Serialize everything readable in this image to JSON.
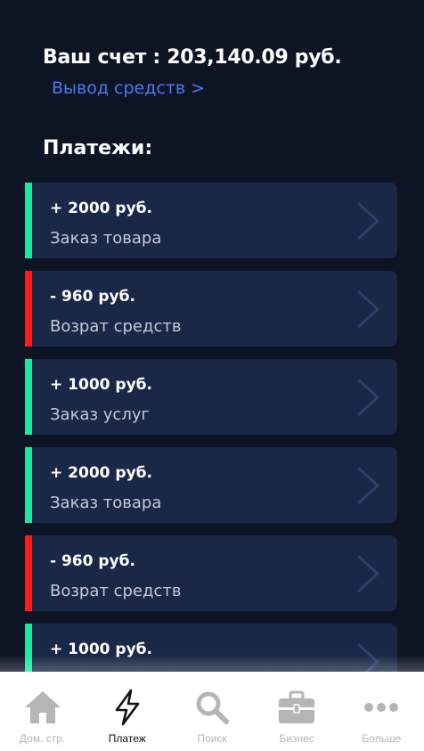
{
  "account": {
    "balance_text": "Ваш счет : 203,140.09 руб.",
    "withdraw_link": "Вывод средств >"
  },
  "payments": {
    "title": "Платежи:",
    "items": [
      {
        "amount": "+ 2000 руб.",
        "description": "Заказ товара",
        "type": "income"
      },
      {
        "amount": "- 960 руб.",
        "description": "Возрат средств",
        "type": "expense"
      },
      {
        "amount": "+ 1000 руб.",
        "description": "Заказ услуг",
        "type": "income"
      },
      {
        "amount": "+ 2000 руб.",
        "description": "Заказ товара",
        "type": "income"
      },
      {
        "amount": "- 960 руб.",
        "description": "Возрат средств",
        "type": "expense"
      },
      {
        "amount": "+ 1000 руб.",
        "description": "",
        "type": "income"
      }
    ]
  },
  "tabbar": {
    "items": [
      {
        "label": "Дом. стр.",
        "icon": "home-icon",
        "active": false
      },
      {
        "label": "Платеж",
        "icon": "lightning-icon",
        "active": true
      },
      {
        "label": "Поиск",
        "icon": "search-icon",
        "active": false
      },
      {
        "label": "Бизнес",
        "icon": "briefcase-icon",
        "active": false
      },
      {
        "label": "Больше",
        "icon": "more-icon",
        "active": false
      }
    ]
  },
  "colors": {
    "background": "#0d1424",
    "card": "#1a2847",
    "income": "#1ee8a0",
    "expense": "#ff1a1a",
    "link": "#4a7bf2"
  }
}
